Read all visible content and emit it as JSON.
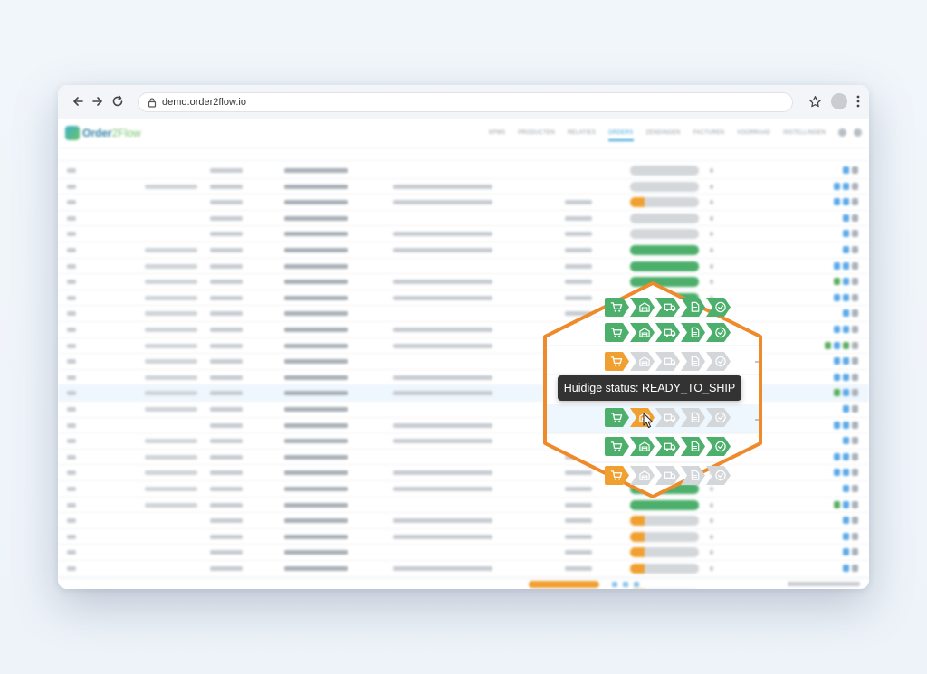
{
  "browser": {
    "url": "demo.order2flow.io"
  },
  "app": {
    "logo_text_main": "Order",
    "logo_text_accent": "2Flow",
    "menu": [
      "KPMS",
      "PRODUCTEN",
      "RELATIES",
      "ORDERS",
      "ZENDINGEN",
      "FACTUREN",
      "VOORRAAD",
      "INSTELLINGEN"
    ],
    "active_menu": "ORDERS"
  },
  "zoom": {
    "tooltip": "Huidige status: READY_TO_SHIP",
    "rows": [
      {
        "state": "done",
        "steps": 5
      },
      {
        "state": "done",
        "steps": 5
      },
      {
        "state": "first",
        "steps": 5
      },
      {
        "state": "first",
        "steps": 5
      },
      {
        "state": "current2",
        "steps": 5
      },
      {
        "state": "done",
        "steps": 5
      },
      {
        "state": "first",
        "steps": 5
      }
    ],
    "step_icons": [
      "cart-icon",
      "warehouse-icon",
      "truck-icon",
      "document-icon",
      "check-circle-icon"
    ],
    "colors": {
      "done": "#4caf6b",
      "current": "#f0a030",
      "pending": "#d4d7da",
      "border": "#ef8a2a"
    }
  }
}
